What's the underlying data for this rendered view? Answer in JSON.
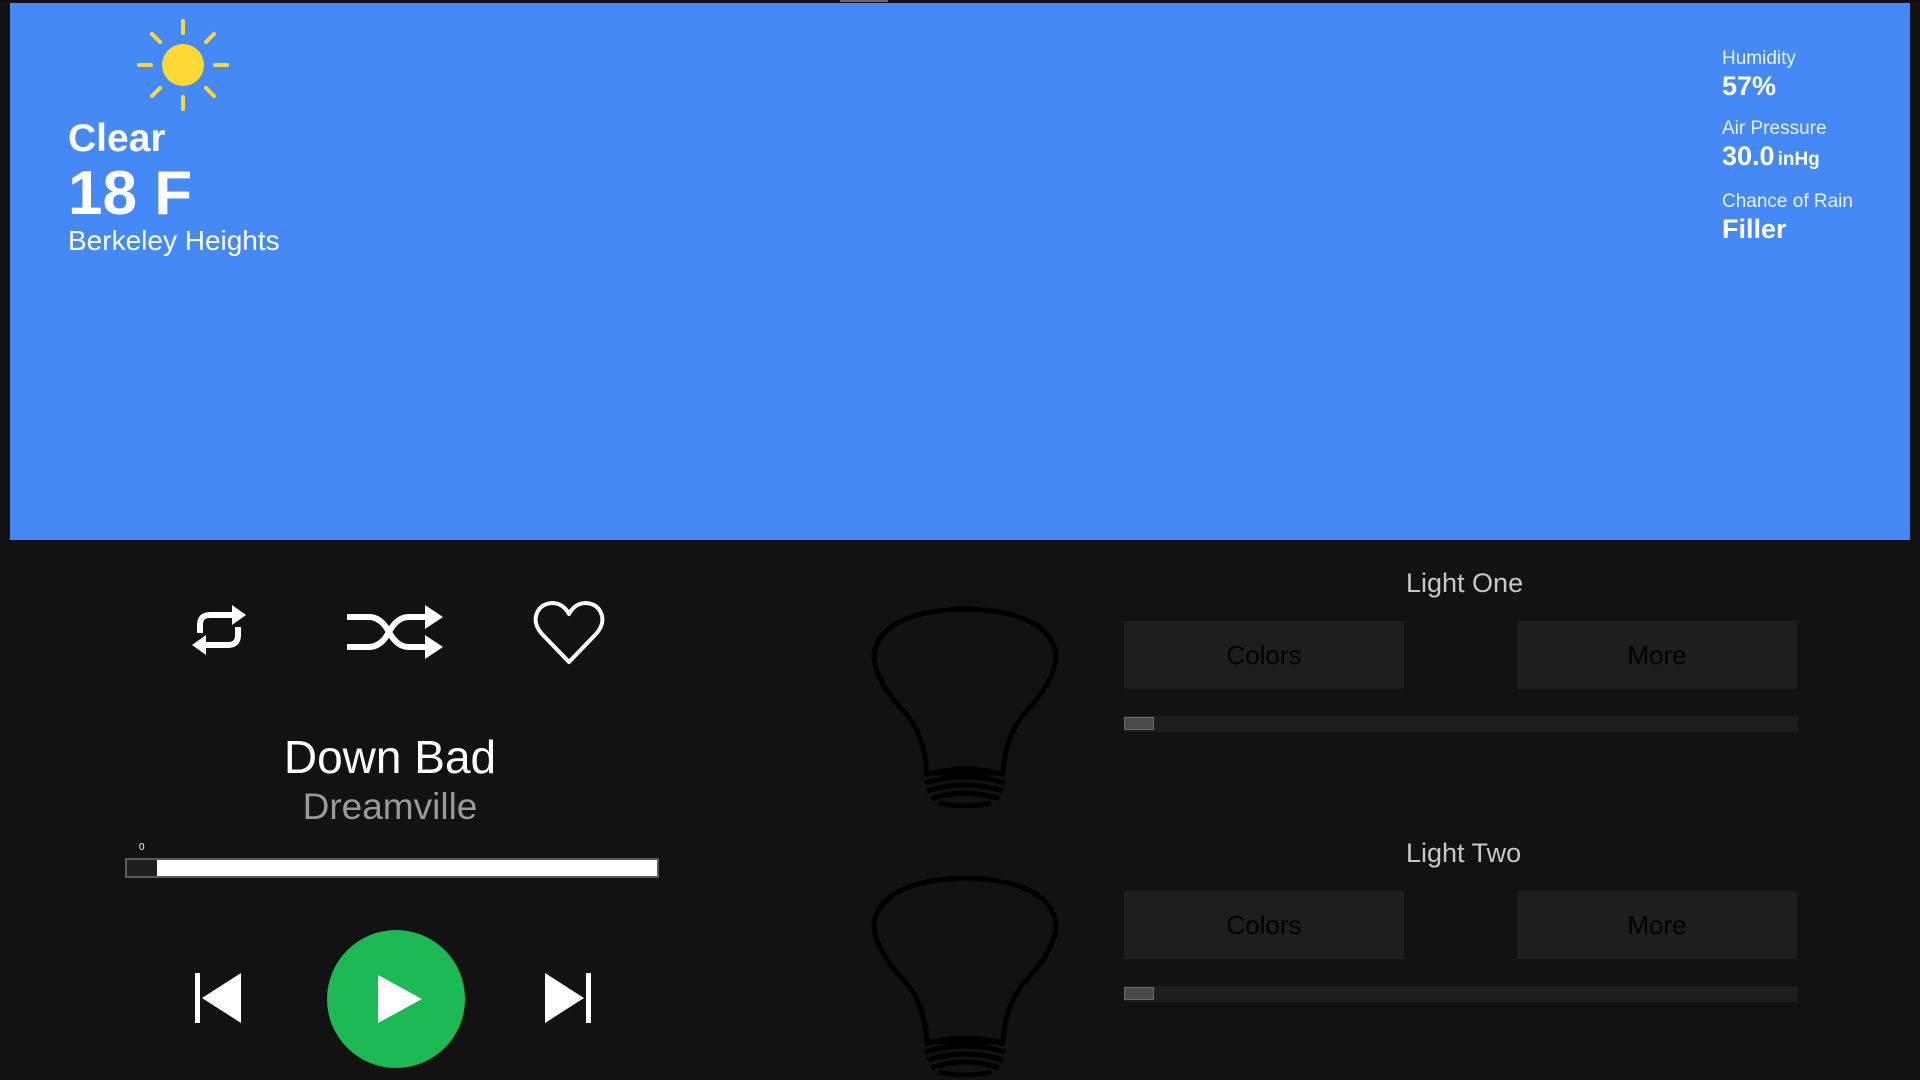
{
  "weather": {
    "condition": "Clear",
    "temperature": "18 F",
    "location": "Berkeley Heights",
    "icon": "sun-icon",
    "stats": [
      {
        "label": "Humidity",
        "value": "57%",
        "unit": ""
      },
      {
        "label": "Air Pressure",
        "value": "30.0",
        "unit": "inHg"
      },
      {
        "label": "Chance of Rain",
        "value": "Filler",
        "unit": ""
      }
    ]
  },
  "player": {
    "song_title": "Down Bad",
    "artist": "Dreamville",
    "progress_value": "0",
    "progress_fraction": 0,
    "controls": {
      "repeat_icon": "repeat-icon",
      "shuffle_icon": "shuffle-icon",
      "like_icon": "heart-icon",
      "previous_icon": "skip-previous-icon",
      "play_icon": "play-icon",
      "next_icon": "skip-next-icon"
    }
  },
  "lights": [
    {
      "name": "Light One",
      "colors_label": "Colors",
      "more_label": "More",
      "brightness_fraction": 0
    },
    {
      "name": "Light Two",
      "colors_label": "Colors",
      "more_label": "More",
      "brightness_fraction": 0
    }
  ],
  "colors": {
    "weather_background": "#4589f7",
    "page_background": "#121212",
    "play_button": "#1db954",
    "sun": "#fcd934"
  }
}
